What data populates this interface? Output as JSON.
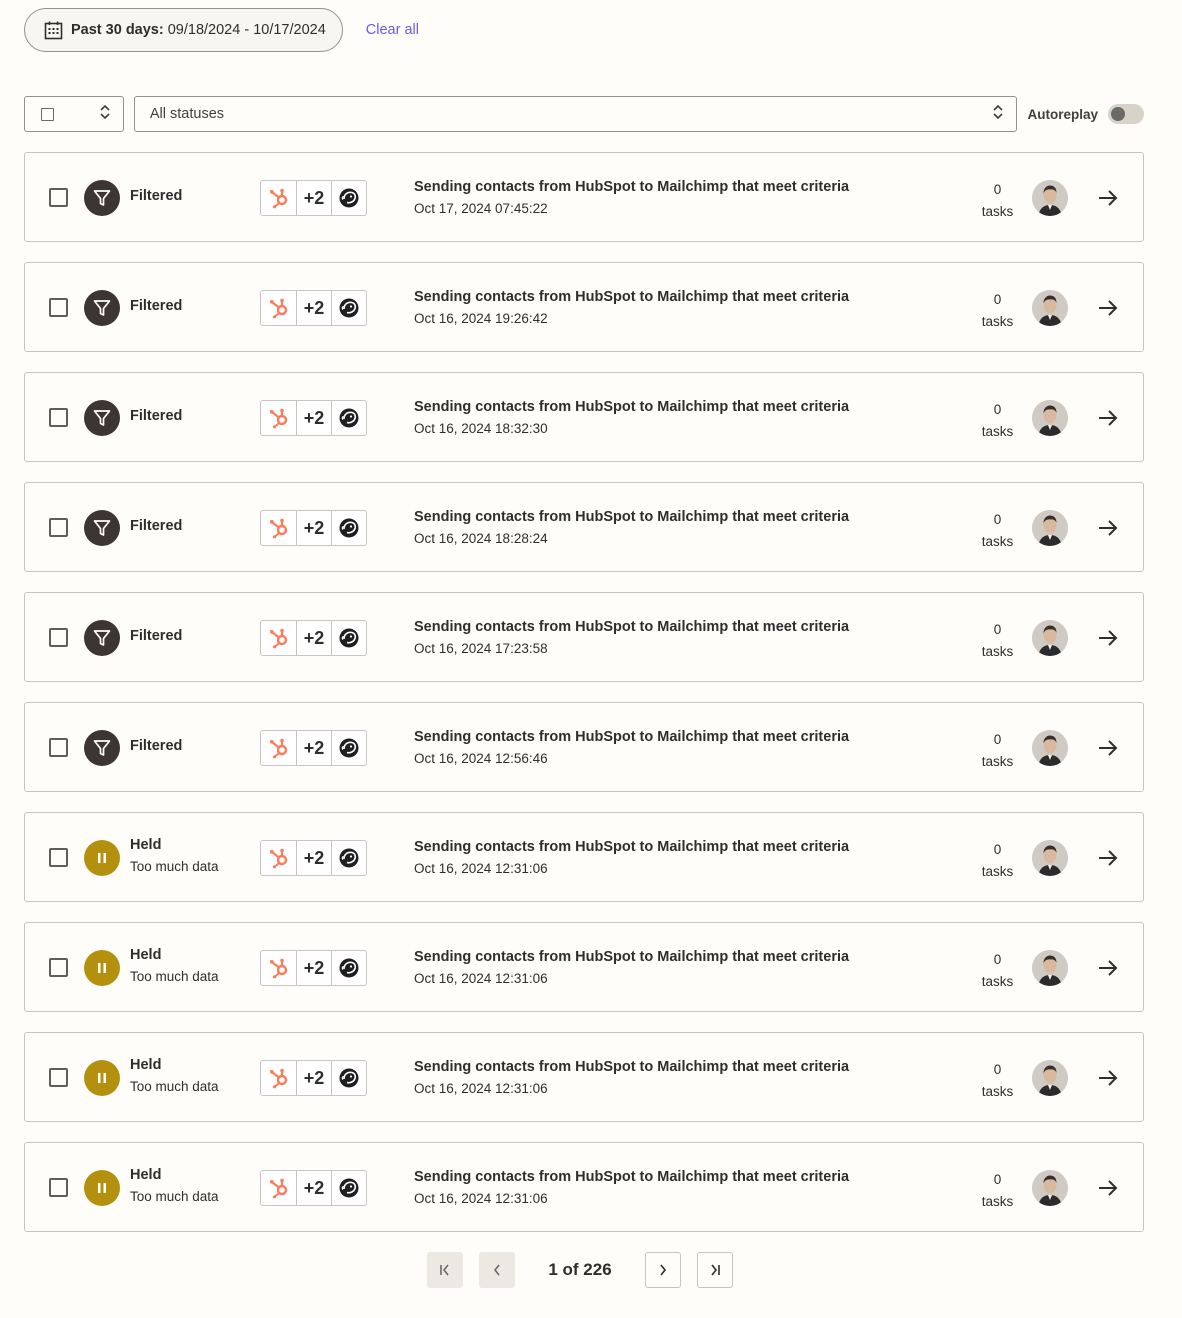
{
  "date_filter": {
    "label": "Past 30 days:",
    "range": "09/18/2024 - 10/17/2024"
  },
  "clear_all": "Clear all",
  "status_filter": {
    "value": "All statuses"
  },
  "autoreplay": {
    "label": "Autoreplay",
    "enabled": false
  },
  "runs": [
    {
      "status": "Filtered",
      "status_type": "filtered",
      "sub": "",
      "more_apps": "+2",
      "title": "Sending contacts from HubSpot to Mailchimp that meet criteria",
      "date": "Oct 17, 2024 07:45:22",
      "tasks_count": "0",
      "tasks_label": "tasks"
    },
    {
      "status": "Filtered",
      "status_type": "filtered",
      "sub": "",
      "more_apps": "+2",
      "title": "Sending contacts from HubSpot to Mailchimp that meet criteria",
      "date": "Oct 16, 2024 19:26:42",
      "tasks_count": "0",
      "tasks_label": "tasks"
    },
    {
      "status": "Filtered",
      "status_type": "filtered",
      "sub": "",
      "more_apps": "+2",
      "title": "Sending contacts from HubSpot to Mailchimp that meet criteria",
      "date": "Oct 16, 2024 18:32:30",
      "tasks_count": "0",
      "tasks_label": "tasks"
    },
    {
      "status": "Filtered",
      "status_type": "filtered",
      "sub": "",
      "more_apps": "+2",
      "title": "Sending contacts from HubSpot to Mailchimp that meet criteria",
      "date": "Oct 16, 2024 18:28:24",
      "tasks_count": "0",
      "tasks_label": "tasks"
    },
    {
      "status": "Filtered",
      "status_type": "filtered",
      "sub": "",
      "more_apps": "+2",
      "title": "Sending contacts from HubSpot to Mailchimp that meet criteria",
      "date": "Oct 16, 2024 17:23:58",
      "tasks_count": "0",
      "tasks_label": "tasks"
    },
    {
      "status": "Filtered",
      "status_type": "filtered",
      "sub": "",
      "more_apps": "+2",
      "title": "Sending contacts from HubSpot to Mailchimp that meet criteria",
      "date": "Oct 16, 2024 12:56:46",
      "tasks_count": "0",
      "tasks_label": "tasks"
    },
    {
      "status": "Held",
      "status_type": "held",
      "sub": "Too much data",
      "more_apps": "+2",
      "title": "Sending contacts from HubSpot to Mailchimp that meet criteria",
      "date": "Oct 16, 2024 12:31:06",
      "tasks_count": "0",
      "tasks_label": "tasks"
    },
    {
      "status": "Held",
      "status_type": "held",
      "sub": "Too much data",
      "more_apps": "+2",
      "title": "Sending contacts from HubSpot to Mailchimp that meet criteria",
      "date": "Oct 16, 2024 12:31:06",
      "tasks_count": "0",
      "tasks_label": "tasks"
    },
    {
      "status": "Held",
      "status_type": "held",
      "sub": "Too much data",
      "more_apps": "+2",
      "title": "Sending contacts from HubSpot to Mailchimp that meet criteria",
      "date": "Oct 16, 2024 12:31:06",
      "tasks_count": "0",
      "tasks_label": "tasks"
    },
    {
      "status": "Held",
      "status_type": "held",
      "sub": "Too much data",
      "more_apps": "+2",
      "title": "Sending contacts from HubSpot to Mailchimp that meet criteria",
      "date": "Oct 16, 2024 12:31:06",
      "tasks_count": "0",
      "tasks_label": "tasks"
    }
  ],
  "pagination": {
    "current": "1",
    "of_label": "of",
    "total": "226"
  },
  "colors": {
    "accent": "#695be8",
    "filtered": "#3d3532",
    "held": "#b3910f",
    "hubspot": "#ff7a59"
  },
  "icons": {
    "date": "calendar-icon",
    "filtered": "filter-funnel-icon",
    "held": "pause-icon",
    "open": "arrow-right-icon"
  }
}
